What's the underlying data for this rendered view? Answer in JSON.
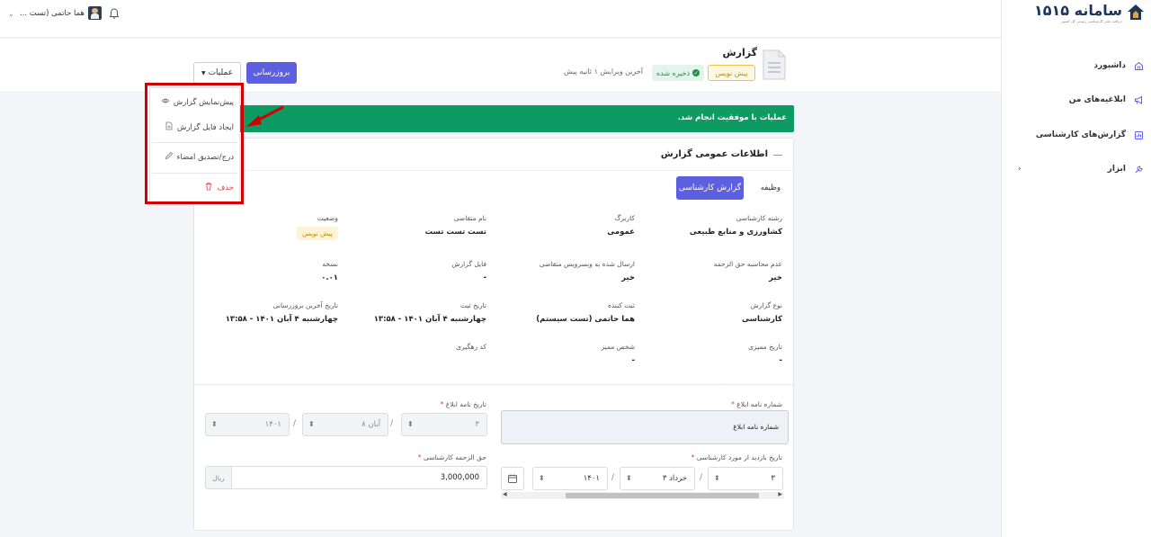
{
  "topbar": {
    "user_name": "هما حاتمی (تست ...",
    "bell_icon": "bell-icon",
    "chevron_icon": "chevron-down-icon"
  },
  "sidebar": {
    "logo_text": "سامانه ۱۵۱۵",
    "logo_subtitle": "دریافت ملی کارشناسی رسمی کل کشور",
    "items": [
      {
        "label": "داشبورد",
        "icon": "home-icon"
      },
      {
        "label": "ابلاغیه‌های من",
        "icon": "megaphone-icon"
      },
      {
        "label": "گزارش‌های کارشناسی",
        "icon": "report-icon"
      },
      {
        "label": "ابزار",
        "icon": "tools-icon"
      }
    ],
    "expand_icon": "chevron-left-icon"
  },
  "header": {
    "title": "گزارش",
    "badge_draft": "پیش نویس",
    "badge_saved": "ذخیره شده",
    "last_edit": "آخرین ویرایش ۱ ثانیه پیش",
    "update_button": "بروزرسانی",
    "operations_button": "عملیات"
  },
  "menu": {
    "items": [
      {
        "label": "پیش‌نمایش گزارش",
        "icon": "eye-icon"
      },
      {
        "label": "ایجاد فایل گزارش",
        "icon": "file-plus-icon"
      },
      {
        "label": "درج/تصدیق امضاء",
        "icon": "pen-icon"
      },
      {
        "label": "حذف",
        "icon": "trash-icon"
      }
    ]
  },
  "alert": {
    "text": "عملیات با موفقیت انجام شد."
  },
  "card": {
    "title": "اطلاعات عمومی گزارش",
    "tabs": [
      {
        "label": "گزارش کارشناسی",
        "active": true
      },
      {
        "label": "وظیفه",
        "active": false
      }
    ],
    "fields": [
      {
        "label": "رشته کارشناسی",
        "value": "کشاورزی و منابع طبیعی"
      },
      {
        "label": "کاربرگ",
        "value": "عمومی"
      },
      {
        "label": "نام متقاضی",
        "value": "تست تست تست"
      },
      {
        "label": "وضعیت",
        "value": "پیش نویس"
      },
      {
        "label": "عدم محاسبه حق الزحمه",
        "value": "خیر"
      },
      {
        "label": "ارسال شده به وبسرویس متقاضی",
        "value": "خیر"
      },
      {
        "label": "فایل گزارش",
        "value": "-"
      },
      {
        "label": "نسخه",
        "value": "۰.۰۱"
      },
      {
        "label": "نوع گزارش",
        "value": "کارشناسی"
      },
      {
        "label": "ثبت کننده",
        "value": "هما حاتمی (تست سیستم)"
      },
      {
        "label": "تاریخ ثبت",
        "value": "چهارشنبه ۴ آبان ۱۴۰۱ - ۱۳:۵۸"
      },
      {
        "label": "تاریخ آخرین بروزرسانی",
        "value": "چهارشنبه ۴ آبان ۱۴۰۱ - ۱۳:۵۸"
      },
      {
        "label": "تاریخ ممیزی",
        "value": "-"
      },
      {
        "label": "شخص ممیز",
        "value": "-"
      },
      {
        "label": "کد رهگیری",
        "value": ""
      }
    ]
  },
  "form": {
    "notice_number_label": "شماره نامه ابلاغ",
    "notice_number_value": "شماره نامه ابلاغ",
    "notice_date_label": "تاریخ نامه ابلاغ",
    "notice_date": {
      "day": "۳",
      "month": "۸ آبان",
      "year": "۱۴۰۱"
    },
    "visit_date_label": "تاریخ بازدید از مورد کارشناسی",
    "visit_date": {
      "day": "۳",
      "month": "۳ خرداد",
      "year": "۱۴۰۱"
    },
    "fee_label": "حق الزحمه کارشناسی",
    "fee_value": "3,000,000",
    "fee_unit": "ریال",
    "calendar_icon": "calendar-icon"
  },
  "colors": {
    "primary": "#5b5fe0",
    "success": "#0e9a63",
    "danger": "#e23c3c",
    "annotation": "#d40000"
  }
}
